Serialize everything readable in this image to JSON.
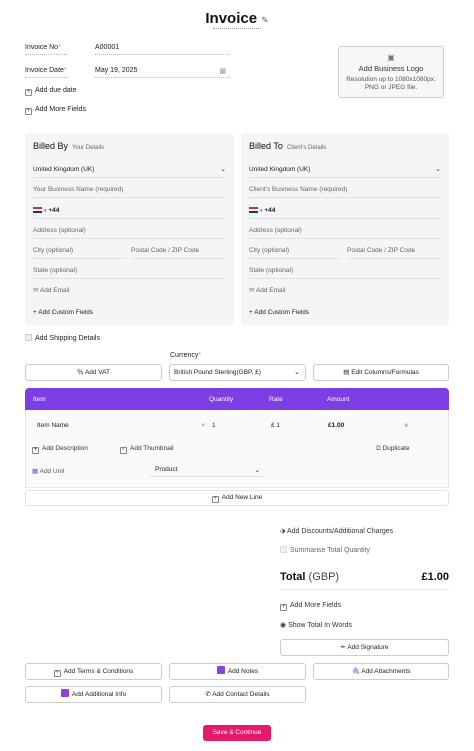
{
  "header": {
    "title": "Invoice"
  },
  "invoice": {
    "no_label": "Invoice No",
    "no_value": "A00001",
    "date_label": "Invoice Date",
    "date_value": "May 19, 2025",
    "add_due_date": "Add due date",
    "add_more_fields": "Add More Fields",
    "required_mark": "*"
  },
  "logo": {
    "title": "Add Business Logo",
    "desc1": "Resolution up to 1080x1080px.",
    "desc2": "PNG or JPEG file."
  },
  "billed_by": {
    "title": "Billed By",
    "subtitle": "Your Details",
    "country": "United Kingdom (UK)",
    "name_placeholder": "Your Business Name (required)",
    "phone_code": "+44",
    "address": "Address (optional)",
    "city": "City (optional)",
    "postal": "Postal Code / ZIP Code",
    "state": "State (optional)",
    "add_email": "Add Email",
    "add_custom": "Add Custom Fields"
  },
  "billed_to": {
    "title": "Billed To",
    "subtitle": "Client's Details",
    "country": "United Kingdom (UK)",
    "name_placeholder": "Client's Business Name (required)",
    "phone_code": "+44",
    "address": "Address (optional)",
    "city": "City (optional)",
    "postal": "Postal Code / ZIP Code",
    "state": "State (optional)",
    "add_email": "Add Email",
    "add_custom": "Add Custom Fields"
  },
  "shipping": {
    "label": "Add Shipping Details"
  },
  "currency": {
    "label": "Currency",
    "value": "British Pound Sterling(GBP, £)"
  },
  "toolbar": {
    "add_vat": "Add VAT",
    "edit_columns": "Edit Columns/Formulas"
  },
  "table": {
    "headers": [
      "Item",
      "Quantity",
      "Rate",
      "Amount"
    ],
    "row": {
      "name": "Item Name",
      "quantity": "1",
      "rate": "£ 1",
      "amount": "£1.00",
      "add_description": "Add Description",
      "add_thumbnail": "Add Thumbnail",
      "duplicate": "Duplicate",
      "add_unit": "Add Unit",
      "unit_value": "Product"
    },
    "add_new_line": "Add New Line"
  },
  "summary": {
    "discounts": "Add Discounts/Additional Charges",
    "summarise_qty": "Summarise Total Quantity",
    "total_label": "Total",
    "total_currency": "(GBP)",
    "total_value": "£1.00",
    "add_more_fields": "Add More Fields",
    "show_total_words": "Show Total In Words",
    "add_signature": "Add Signature"
  },
  "extras": {
    "terms": "Add Terms & Conditions",
    "notes": "Add Notes",
    "attachments": "Add Attachments",
    "additional_info": "Add Additional Info",
    "contact": "Add Contact Details"
  },
  "footer": {
    "save_continue": "Save & Continue"
  },
  "colors": {
    "accent": "#7b3fe4",
    "cta": "#e6196b",
    "panel": "#f5f5f7"
  }
}
